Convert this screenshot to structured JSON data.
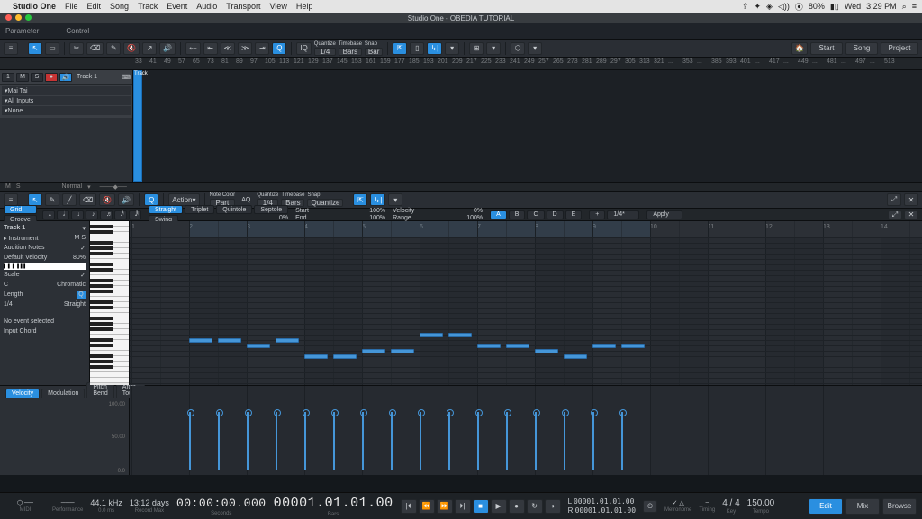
{
  "menubar": {
    "app": "Studio One",
    "items": [
      "File",
      "Edit",
      "Song",
      "Track",
      "Event",
      "Audio",
      "Transport",
      "View",
      "Help"
    ],
    "right": {
      "wifi_pct": "80%",
      "day": "Wed",
      "time": "3:29 PM"
    }
  },
  "window": {
    "title": "Studio One - OBEDIA TUTORIAL"
  },
  "paramrow": {
    "left": "Parameter",
    "right": "Control"
  },
  "toolbar": {
    "quantize": {
      "label": "Quantize",
      "value": "1/4"
    },
    "timebase": {
      "label": "Timebase",
      "value": "Bars"
    },
    "snap": {
      "label": "Snap",
      "value": "Bar"
    },
    "start_btn": "Start",
    "song_btn": "Song",
    "project_btn": "Project"
  },
  "ruler_top": [
    33,
    41,
    49,
    57,
    65,
    73,
    81,
    89,
    97,
    105,
    113,
    121,
    129,
    137,
    145,
    153,
    161,
    169,
    177,
    185,
    193,
    201,
    209,
    217,
    225,
    233,
    241,
    249,
    257,
    265,
    273,
    281,
    289,
    297,
    305,
    313,
    321,
    "...",
    353,
    "...",
    385,
    393,
    401,
    "...",
    417,
    "...",
    449,
    "...",
    481,
    "...",
    497,
    "...",
    513
  ],
  "track": {
    "num": "1",
    "name": "Track 1",
    "io": [
      "Mai Tai",
      "All Inputs",
      "None"
    ]
  },
  "status": {
    "m": "M",
    "s": "S",
    "mode": "Normal"
  },
  "editbar": {
    "action": "Action",
    "notecolor": {
      "label": "Note Color",
      "value": "Part"
    },
    "quantize": {
      "label": "Quantize",
      "value": "1/4"
    },
    "timebase": {
      "label": "Timebase",
      "value": "Bars"
    },
    "snap": {
      "label": "Snap",
      "value": "Quantize"
    },
    "aq": "AQ"
  },
  "quantrow": {
    "grid": "Grid",
    "groove": "Groove",
    "mode": {
      "straight": "Straight",
      "swing": "Swing",
      "triplet": "Triplet",
      "quintole": "Quintole",
      "septole": "Septole"
    },
    "swing_pct": "0%",
    "start": {
      "label": "Start",
      "val": "100%"
    },
    "end": {
      "label": "End",
      "val": "100%"
    },
    "velocity": {
      "label": "Velocity",
      "val": "0%"
    },
    "range": {
      "label": "Range",
      "val": "100%"
    },
    "slots": [
      "A",
      "B",
      "C",
      "D",
      "E"
    ],
    "plus": "+",
    "length_val": "1/4*",
    "apply": "Apply"
  },
  "props": {
    "track": "Track 1",
    "instrument": "Instrument",
    "audition": "Audition Notes",
    "defvel": {
      "label": "Default Velocity",
      "val": "80%"
    },
    "scale": "Scale",
    "note": "C",
    "scale_name": "Chromatic",
    "length": "Length",
    "length_val": "1/4",
    "length_mode": "Straight",
    "noevt": "No event selected",
    "inchord": "Input Chord"
  },
  "editor_ruler": [
    1,
    2,
    3,
    4,
    5,
    6,
    7,
    8,
    9,
    10,
    11,
    12,
    13,
    14
  ],
  "notes": [
    {
      "bar": 2.0,
      "row": 4
    },
    {
      "bar": 2.5,
      "row": 4
    },
    {
      "bar": 3.0,
      "row": 5
    },
    {
      "bar": 3.5,
      "row": 4
    },
    {
      "bar": 4.0,
      "row": 7
    },
    {
      "bar": 4.5,
      "row": 7
    },
    {
      "bar": 5.0,
      "row": 6
    },
    {
      "bar": 5.5,
      "row": 6
    },
    {
      "bar": 6.0,
      "row": 3
    },
    {
      "bar": 6.5,
      "row": 3
    },
    {
      "bar": 7.0,
      "row": 5
    },
    {
      "bar": 7.5,
      "row": 5
    },
    {
      "bar": 8.0,
      "row": 6
    },
    {
      "bar": 8.5,
      "row": 7
    },
    {
      "bar": 9.0,
      "row": 5
    },
    {
      "bar": 9.5,
      "row": 5
    }
  ],
  "loop": {
    "start": 2,
    "end": 10
  },
  "vel": {
    "tabs": [
      "Velocity",
      "Modulation",
      "Pitch Bend",
      "After Touch"
    ],
    "scale": [
      "100.00",
      "50.00",
      "0.0"
    ],
    "bars": [
      2.0,
      2.5,
      3.0,
      3.5,
      4.0,
      4.5,
      5.0,
      5.5,
      6.0,
      6.5,
      7.0,
      7.5,
      8.0,
      8.5,
      9.0,
      9.5
    ],
    "height": 64
  },
  "transport": {
    "midi": "MIDI",
    "perf": "Performance",
    "rate": "44.1 kHz",
    "rec": "13:12 days",
    "recmax": "Record Max",
    "ms": "0.0 ms",
    "time1": "00:00:00.000",
    "seconds": "Seconds",
    "time2": "00001.01.01.00",
    "bars": "Bars",
    "l": "L",
    "r": "R",
    "lval": "00001.01.01.00",
    "rval": "00001.01.01.00",
    "sigL": "Timing",
    "sig": "4 / 4",
    "key": "Key",
    "tempo": "Tempo",
    "tempo_val": "150.00",
    "metro": "Metronome",
    "edit": "Edit",
    "mix": "Mix",
    "browse": "Browse"
  }
}
